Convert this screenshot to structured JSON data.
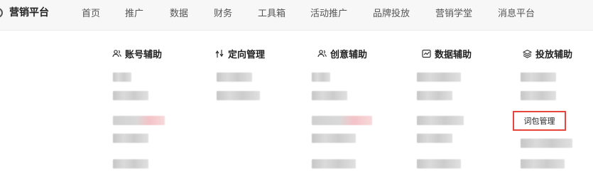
{
  "header": {
    "brand": "营销平台",
    "nav": [
      "首页",
      "推广",
      "数据",
      "财务",
      "工具箱",
      "活动推广",
      "品牌投放",
      "营销学堂",
      "消息平台"
    ]
  },
  "columns": [
    {
      "title": "账号辅助",
      "icon": "user-group-icon"
    },
    {
      "title": "定向管理",
      "icon": "routing-arrows-icon"
    },
    {
      "title": "创意辅助",
      "icon": "user-group-icon"
    },
    {
      "title": "数据辅助",
      "icon": "chart-box-icon"
    },
    {
      "title": "投放辅助",
      "icon": "layers-icon"
    }
  ],
  "highlighted_item": "词包管理",
  "colors": {
    "highlight_border": "#e7463d"
  }
}
